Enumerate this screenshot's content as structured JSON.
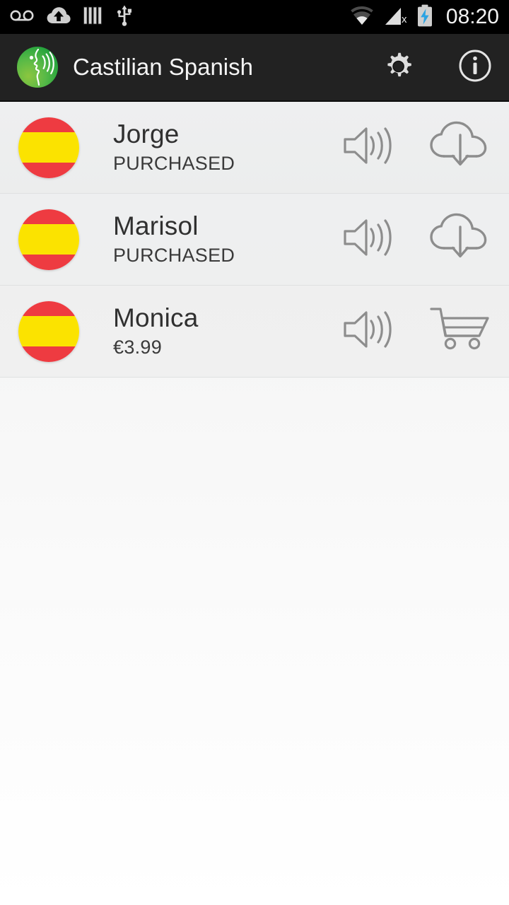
{
  "status_bar": {
    "icons_left": [
      "voicemail-icon",
      "cloud-upload-icon",
      "bars-icon",
      "usb-icon"
    ],
    "icons_right": [
      "wifi-icon",
      "no-sim-signal-icon",
      "battery-charging-icon"
    ],
    "clock": "08:20"
  },
  "action_bar": {
    "app_icon": "speaking-head-icon",
    "title": "Castilian Spanish",
    "buttons": [
      {
        "name": "settings-button",
        "icon": "gear-icon"
      },
      {
        "name": "info-button",
        "icon": "info-icon"
      }
    ]
  },
  "voices": [
    {
      "flag": "spain-flag-icon",
      "name": "Jorge",
      "status": "PURCHASED",
      "preview_icon": "speaker-icon",
      "action_icon": "cloud-download-icon"
    },
    {
      "flag": "spain-flag-icon",
      "name": "Marisol",
      "status": "PURCHASED",
      "preview_icon": "speaker-icon",
      "action_icon": "cloud-download-icon"
    },
    {
      "flag": "spain-flag-icon",
      "name": "Monica",
      "status": "€3.99",
      "preview_icon": "speaker-icon",
      "action_icon": "shopping-cart-icon"
    }
  ],
  "colors": {
    "status_bar_bg": "#000000",
    "action_bar_bg": "#222222",
    "flag_red": "#ee3b41",
    "flag_yellow": "#fbe300",
    "icon_gray": "#8a8a8a",
    "battery_accent": "#4aaee8"
  }
}
